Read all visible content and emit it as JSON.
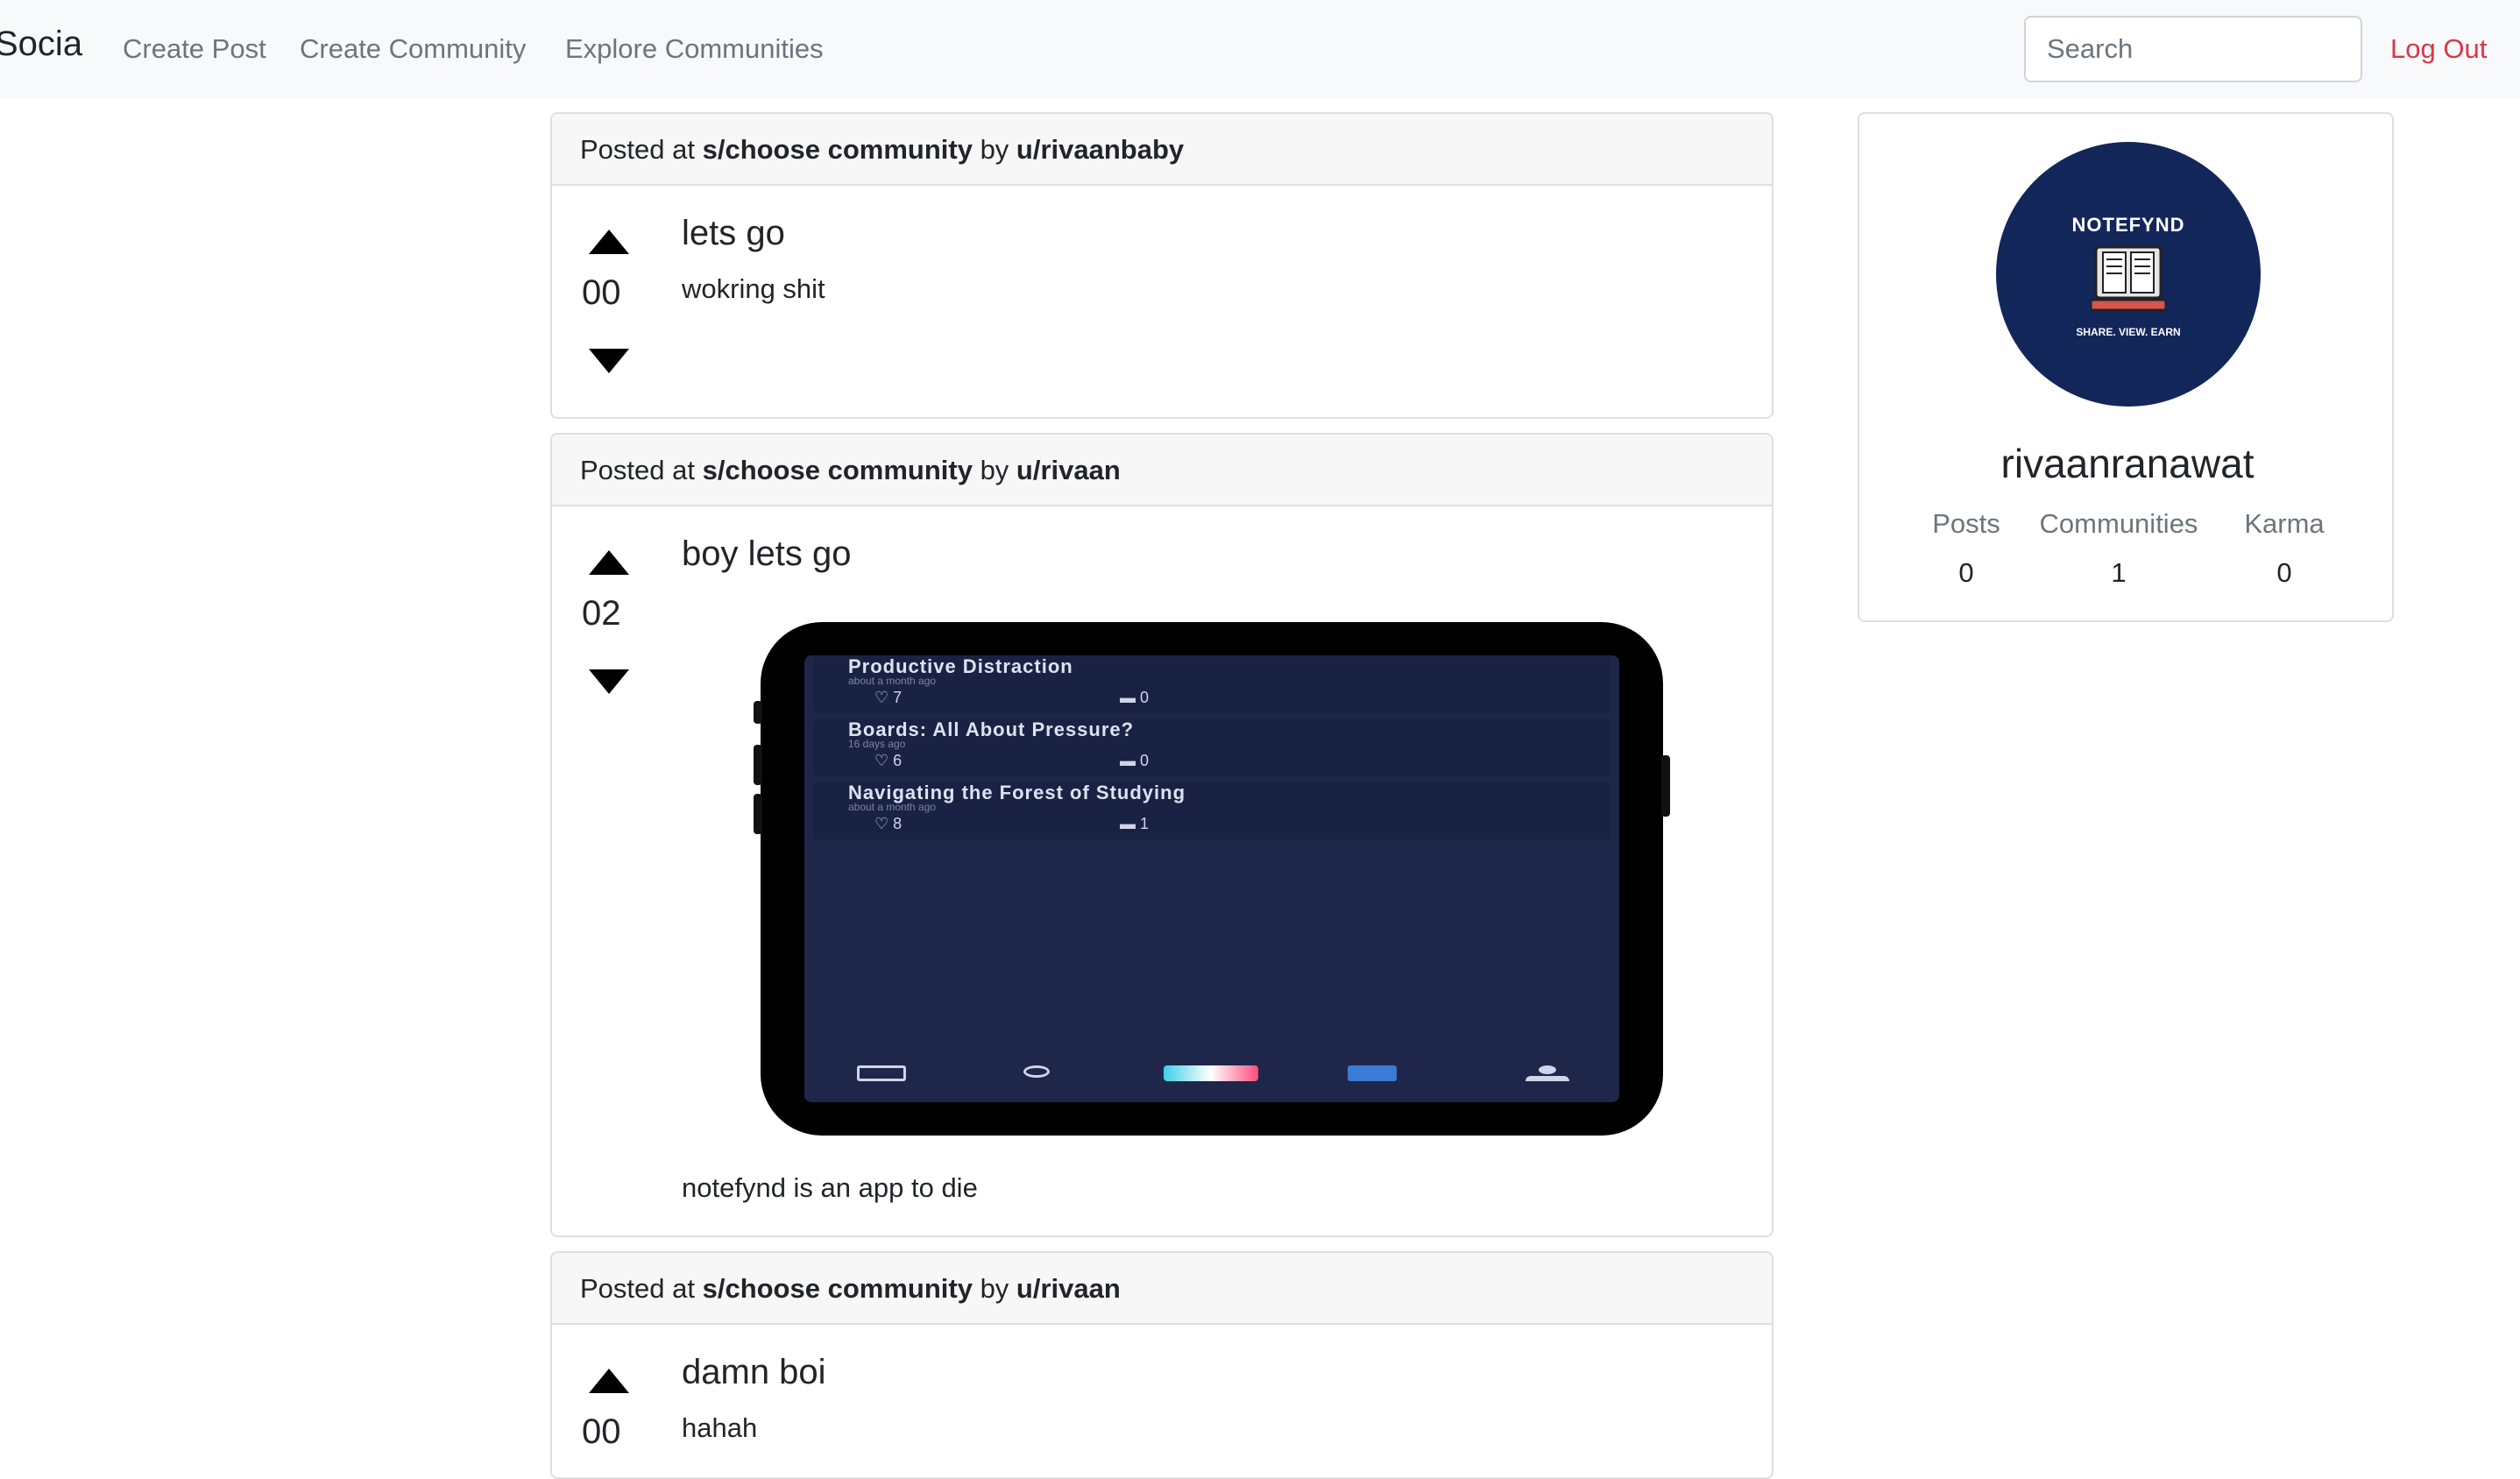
{
  "nav": {
    "brand": "Socia",
    "links": [
      "Create Post",
      "Create Community",
      "Explore Communities"
    ],
    "search_placeholder": "Search",
    "logout": "Log Out"
  },
  "posts": [
    {
      "header_prefix": "Posted at ",
      "community": "s/choose community",
      "by": " by ",
      "author": "u/rivaanbaby",
      "votes": "00",
      "title": "lets go",
      "body": "wokring shit"
    },
    {
      "header_prefix": "Posted at ",
      "community": "s/choose community",
      "by": " by ",
      "author": "u/rivaan",
      "votes": "02",
      "title": "boy lets go",
      "body": "notefynd is an app to die",
      "image": {
        "feed": [
          {
            "title": "Productive Distraction",
            "sub": "about a month ago",
            "likes": "7",
            "comments": "0"
          },
          {
            "title": "Boards: All About Pressure?",
            "sub": "16 days ago",
            "likes": "6",
            "comments": "0"
          },
          {
            "title": "Navigating the Forest of Studying",
            "sub": "about a month ago",
            "likes": "8",
            "comments": "1"
          }
        ]
      }
    },
    {
      "header_prefix": "Posted at ",
      "community": "s/choose community",
      "by": " by ",
      "author": "u/rivaan",
      "votes": "00",
      "title": "damn boi",
      "body": "hahah"
    }
  ],
  "profile": {
    "avatar_top": "NOTEFYND",
    "avatar_bottom": "SHARE. VIEW. EARN",
    "username": "rivaanranawat",
    "stats": [
      {
        "label": "Posts",
        "value": "0"
      },
      {
        "label": "Communities",
        "value": "1"
      },
      {
        "label": "Karma",
        "value": "0"
      }
    ]
  },
  "colors": {
    "navbar_bg": "#f8f9fa",
    "logout": "#dc3545",
    "avatar_bg": "#13265a",
    "muted": "#6c757d"
  }
}
